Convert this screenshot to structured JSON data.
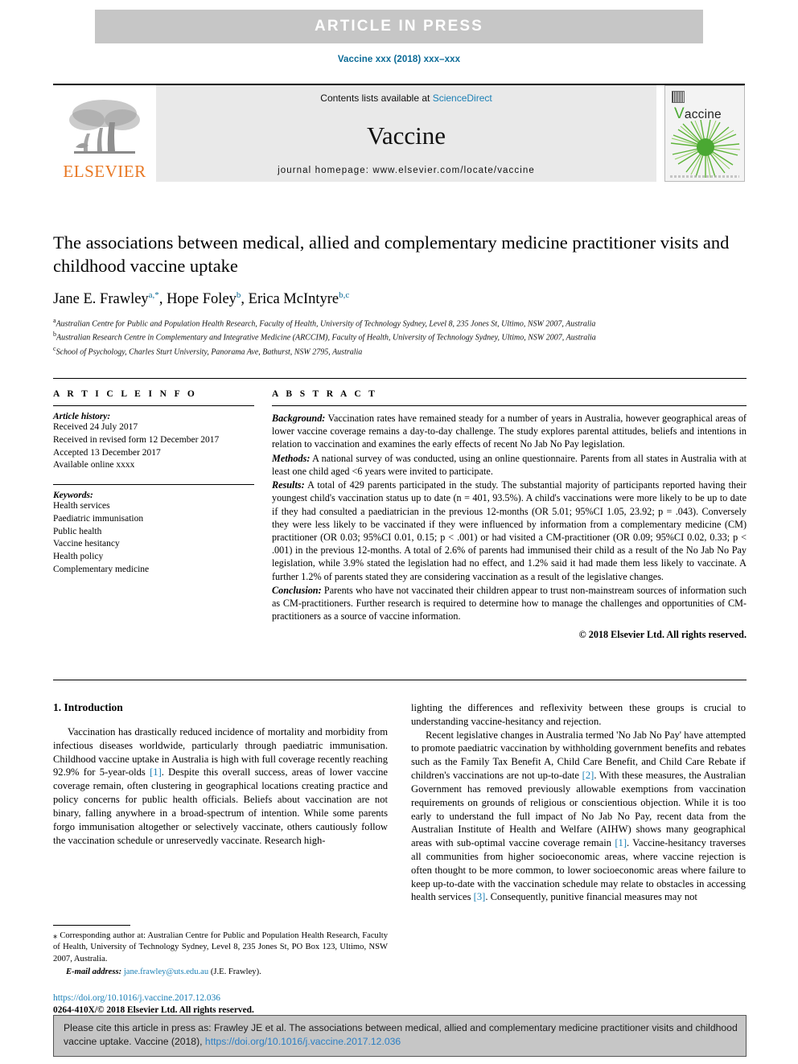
{
  "banner": {
    "text": "ARTICLE  IN  PRESS"
  },
  "running_head": {
    "text": "Vaccine xxx (2018) xxx–xxx"
  },
  "masthead": {
    "contents_prefix": "Contents lists available at ",
    "sciencedirect": "ScienceDirect",
    "journal_title": "Vaccine",
    "homepage": "journal homepage: www.elsevier.com/locate/vaccine",
    "publisher_logo_text": "ELSEVIER",
    "cover_title_initial": "V",
    "cover_title_rest": "accine"
  },
  "article": {
    "title": "The associations between medical, allied and complementary medicine practitioner visits and childhood vaccine uptake",
    "authors": [
      {
        "name": "Jane E. Frawley",
        "marks": "a,*"
      },
      {
        "name": "Hope Foley",
        "marks": "b"
      },
      {
        "name": "Erica McIntyre",
        "marks": "b,c"
      }
    ],
    "authors_line_sep1": ", ",
    "authors_line_sep2": ", ",
    "affiliations": [
      {
        "mark": "a",
        "text": "Australian Centre for Public and Population Health Research, Faculty of Health, University of Technology Sydney, Level 8, 235 Jones St, Ultimo, NSW 2007, Australia"
      },
      {
        "mark": "b",
        "text": "Australian Research Centre in Complementary and Integrative Medicine (ARCCIM), Faculty of Health, University of Technology Sydney, Ultimo, NSW 2007, Australia"
      },
      {
        "mark": "c",
        "text": "School of Psychology, Charles Sturt University, Panorama Ave, Bathurst, NSW 2795, Australia"
      }
    ]
  },
  "article_info": {
    "heading": "A R T I C L E   I N F O",
    "history_label": "Article history:",
    "history": [
      "Received 24 July 2017",
      "Received in revised form 12 December 2017",
      "Accepted 13 December 2017",
      "Available online xxxx"
    ],
    "keywords_label": "Keywords:",
    "keywords": [
      "Health services",
      "Paediatric immunisation",
      "Public health",
      "Vaccine hesitancy",
      "Health policy",
      "Complementary medicine"
    ]
  },
  "abstract": {
    "heading": "A B S T R A C T",
    "sections": [
      {
        "label": "Background:",
        "text": " Vaccination rates have remained steady for a number of years in Australia, however geographical areas of lower vaccine coverage remains a day-to-day challenge. The study explores parental attitudes, beliefs and intentions in relation to vaccination and examines the early effects of recent No Jab No Pay legislation."
      },
      {
        "label": "Methods:",
        "text": " A national survey of was conducted, using an online questionnaire. Parents from all states in Australia with at least one child aged <6 years were invited to participate."
      },
      {
        "label": "Results:",
        "text": " A total of 429 parents participated in the study. The substantial majority of participants reported having their youngest child's vaccination status up to date (n = 401, 93.5%). A child's vaccinations were more likely to be up to date if they had consulted a paediatrician in the previous 12-months (OR 5.01; 95%CI 1.05, 23.92; p = .043). Conversely they were less likely to be vaccinated if they were influenced by information from a complementary medicine (CM) practitioner (OR 0.03; 95%CI 0.01, 0.15; p < .001) or had visited a CM-practitioner (OR 0.09; 95%CI 0.02, 0.33; p < .001) in the previous 12-months. A total of 2.6% of parents had immunised their child as a result of the No Jab No Pay legislation, while 3.9% stated the legislation had no effect, and 1.2% said it had made them less likely to vaccinate. A further 1.2% of parents stated they are considering vaccination as a result of the legislative changes."
      },
      {
        "label": "Conclusion:",
        "text": " Parents who have not vaccinated their children appear to trust non-mainstream sources of information such as CM-practitioners. Further research is required to determine how to manage the challenges and opportunities of CM-practitioners as a source of vaccine information."
      }
    ],
    "copyright": "© 2018 Elsevier Ltd. All rights reserved."
  },
  "introduction": {
    "heading": "1. Introduction",
    "left_paragraph_1": "Vaccination has drastically reduced incidence of mortality and morbidity from infectious diseases worldwide, particularly through paediatric immunisation. Childhood vaccine uptake in Australia is high with full coverage recently reaching 92.9% for 5-year-olds ",
    "left_ref_1": "[1]",
    "left_paragraph_1b": ". Despite this overall success, areas of lower vaccine coverage remain, often clustering in geographical locations creating practice and policy concerns for public health officials. Beliefs about vaccination are not binary, falling anywhere in a broad-spectrum of intention. While some parents forgo immunisation altogether or selectively vaccinate, others cautiously follow the vaccination schedule or unreservedly vaccinate. Research high-",
    "right_paragraph_1": "lighting the differences and reflexivity between these groups is crucial to understanding vaccine-hesitancy and rejection.",
    "right_paragraph_2a": "Recent legislative changes in Australia termed 'No Jab No Pay' have attempted to promote paediatric vaccination by withholding government benefits and rebates such as the Family Tax Benefit A, Child Care Benefit, and Child Care Rebate if children's vaccinations are not up-to-date ",
    "right_ref_2": "[2]",
    "right_paragraph_2b": ". With these measures, the Australian Government has removed previously allowable exemptions from vaccination requirements on grounds of religious or conscientious objection. While it is too early to understand the full impact of No Jab No Pay, recent data from the Australian Institute of Health and Welfare (AIHW) shows many geographical areas with sub-optimal vaccine coverage remain ",
    "right_ref_1": "[1]",
    "right_paragraph_2c": ". Vaccine-hesitancy traverses all communities from higher socioeconomic areas, where vaccine rejection is often thought to be more common, to lower socioeconomic areas where failure to keep up-to-date with the vaccination schedule may relate to obstacles in accessing health services ",
    "right_ref_3": "[3]",
    "right_paragraph_2d": ". Consequently, punitive financial measures may not"
  },
  "footnote": {
    "star": "⁎",
    "corresponding_text": " Corresponding author at: Australian Centre for Public and Population Health Research, Faculty of Health, University of Technology Sydney, Level 8, 235 Jones St, PO Box 123, Ultimo, NSW 2007, Australia.",
    "email_label": "E-mail address:",
    "email": "jane.frawley@uts.edu.au",
    "email_owner": " (J.E. Frawley)."
  },
  "doi_block": {
    "doi_url": "https://doi.org/10.1016/j.vaccine.2017.12.036",
    "issn_line": "0264-410X/© 2018 Elsevier Ltd. All rights reserved."
  },
  "citation_box": {
    "text_before_link": "Please cite this article in press as: Frawley JE et al. The associations between medical, allied and complementary medicine practitioner visits and childhood vaccine uptake. Vaccine (2018), ",
    "link": "https://doi.org/10.1016/j.vaccine.2017.12.036"
  },
  "colors": {
    "link_blue": "#1a7fb5",
    "elsevier_orange": "#e87722",
    "band_gray": "#c6c6c6",
    "masthead_gray": "#e9e9e9",
    "cover_green": "#4aa832"
  }
}
